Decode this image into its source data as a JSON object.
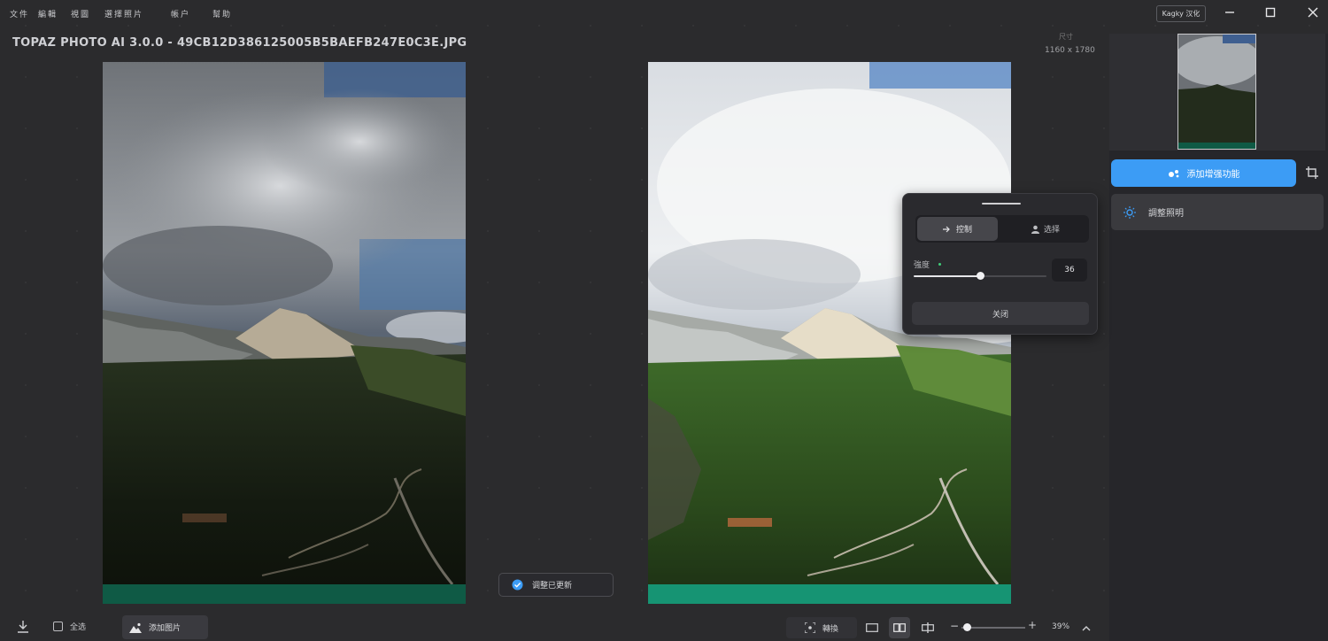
{
  "menu": {
    "file": "文件",
    "edit": "編輯",
    "view": "視圖",
    "select_image": "選擇照片",
    "account": "帳户",
    "help": "幫助"
  },
  "badge": "Kagky 汉化",
  "title": "TOPAZ PHOTO AI 3.0.0 - 49CB12D386125005B5BAEFB247E0C3E.JPG",
  "dims_label": "尺寸",
  "dims": "1160 x 1780",
  "right_panel": {
    "primary_label": "添加增强功能",
    "adjust_label": "調整照明"
  },
  "popup": {
    "tab_auto": "控制",
    "tab_subject": "选择",
    "strength_label": "強度",
    "strength_value": "36",
    "strength_fraction": 0.5,
    "close_label": "关闭"
  },
  "toast": "调整已更新",
  "bottom": {
    "select_all": "全选",
    "add_image": "添加图片",
    "compare": "轉換",
    "zoom_value": "39%"
  },
  "colors": {
    "accent": "#3c9cf5",
    "background": "#2b2b2d",
    "panel": "#26262a",
    "success": "#3fd07a"
  }
}
